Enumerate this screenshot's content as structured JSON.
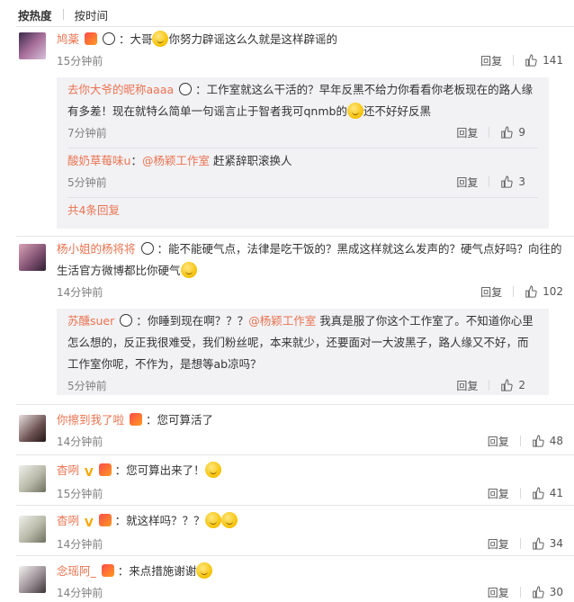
{
  "sort": {
    "hot": "按热度",
    "time": "按时间"
  },
  "comments": [
    {
      "user": "鸠薬",
      "text": "：大哥",
      "text2": "你努力辟谣这么久就是这样辟谣的",
      "time": "15分钟前",
      "reply_label": "回复",
      "likes": "141",
      "replies": [
        {
          "user": "去你大爷的昵称aaaa",
          "text": "：工作室就这么干活的？早年反黑不给力你看看你老板现在的路人缘有多差！现在就特么简单一句谣言止于智者我可qnmb的",
          "text2": "还不好好反黑",
          "time": "7分钟前",
          "reply_label": "回复",
          "likes": "9"
        },
        {
          "user": "酸奶草莓味u",
          "mention": "@杨颖工作室",
          "text": "：",
          "text2": " 赶紧辞职滚换人",
          "time": "5分钟前",
          "reply_label": "回复",
          "likes": "3"
        }
      ],
      "more": "共4条回复"
    },
    {
      "user": "杨小姐的杨将将",
      "text": "：能不能硬气点，法律是吃干饭的？黑成这样就这么发声的？硬气点好吗？向往的生活官方微博都比你硬气",
      "time": "14分钟前",
      "reply_label": "回复",
      "likes": "102",
      "replies": [
        {
          "user": "苏醺suer",
          "text": "：你睡到现在啊？？？",
          "mention": "@杨颖工作室",
          "text2": " 我真是服了你这个工作室了。不知道你心里怎么想的，反正我很难受，我们粉丝呢，本来就少，还要面对一大波黑子，路人缘又不好，而工作室你呢，不作为，是想等ab凉吗？",
          "time": "5分钟前",
          "reply_label": "回复",
          "likes": "2"
        }
      ]
    },
    {
      "user": "你擦到我了啦",
      "text": "：您可算活了",
      "time": "14分钟前",
      "reply_label": "回复",
      "likes": "48"
    },
    {
      "user": "杳咧",
      "text": "：您可算出来了！",
      "time": "15分钟前",
      "reply_label": "回复",
      "likes": "41"
    },
    {
      "user": "杳咧",
      "text": "：就这样吗？？？",
      "time": "14分钟前",
      "reply_label": "回复",
      "likes": "34"
    },
    {
      "user": "念瑶阿_",
      "text": "：来点措施谢谢",
      "time": "14分钟前",
      "reply_label": "回复",
      "likes": "30"
    }
  ]
}
